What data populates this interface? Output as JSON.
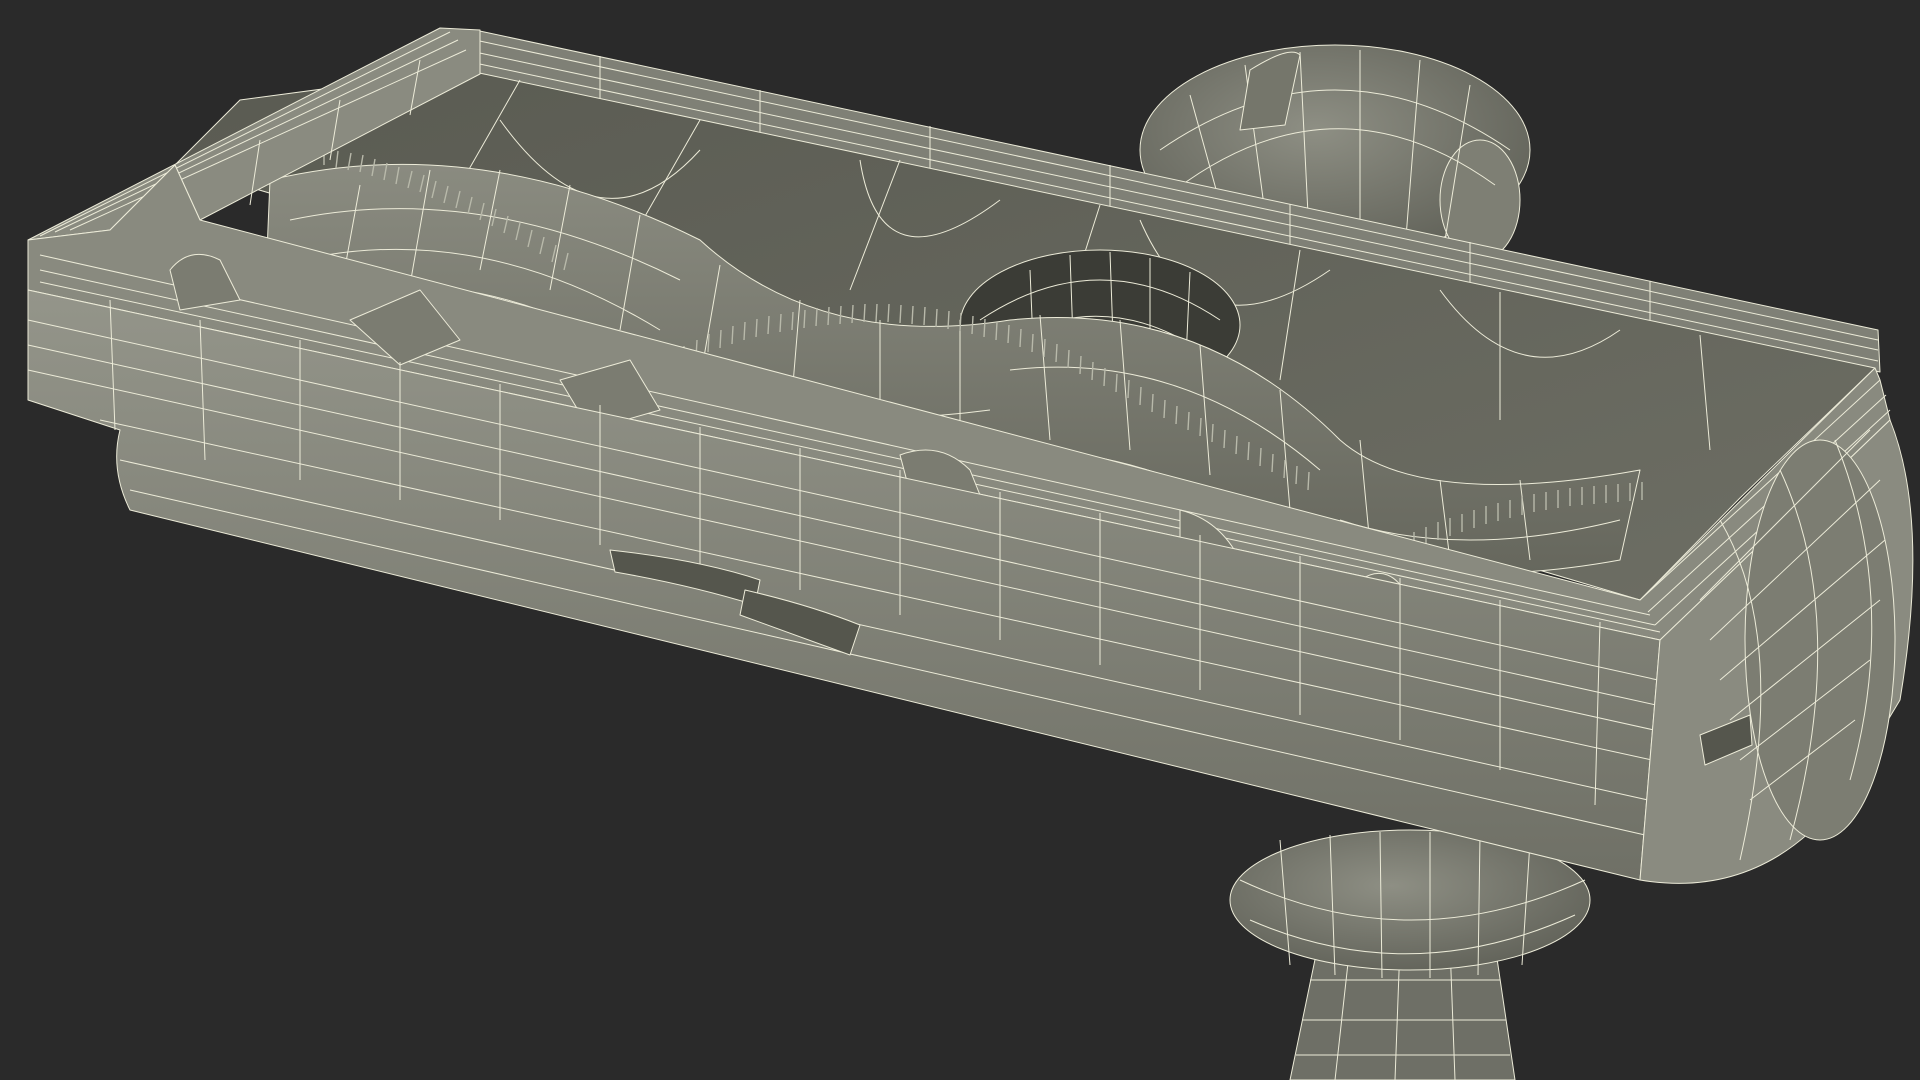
{
  "scene": {
    "subject": "wireframe-render",
    "background_color": "#2a2a2a",
    "shell_color": "#8b8c7f",
    "shell_dark_color": "#55564d",
    "cavity_color": "#65665c",
    "wire_color": "#ecebd8",
    "bristle_color": "#b8b9aa"
  }
}
